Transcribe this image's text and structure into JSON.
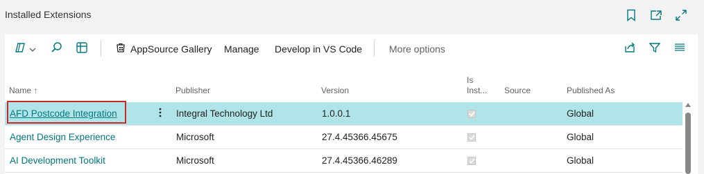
{
  "page": {
    "title": "Installed Extensions"
  },
  "header_actions": [
    {
      "icon": "bookmark-icon"
    },
    {
      "icon": "open-in-new-window-icon"
    },
    {
      "icon": "expand-icon"
    }
  ],
  "toolbar": {
    "view_switch_icon": "analysis-mode-icon",
    "search_icon": "search-icon",
    "layout_icon": "page-layout-icon",
    "appsource_label": "AppSource Gallery",
    "manage_label": "Manage",
    "develop_label": "Develop in VS Code",
    "more_label": "More options",
    "share_icon": "share-icon",
    "filter_icon": "filter-icon",
    "list_icon": "list-view-icon"
  },
  "table": {
    "columns": {
      "name": "Name",
      "name_sort": "↑",
      "publisher": "Publisher",
      "version": "Version",
      "is_installed_line1": "Is",
      "is_installed_line2": "Inst...",
      "source": "Source",
      "published_as": "Published As"
    },
    "rows": [
      {
        "name": "AFD Postcode Integration",
        "publisher": "Integral Technology Ltd",
        "version": "1.0.0.1",
        "is_installed": true,
        "source": "",
        "published_as": "Global",
        "selected": true
      },
      {
        "name": "Agent Design Experience",
        "publisher": "Microsoft",
        "version": "27.4.45366.45675",
        "is_installed": true,
        "source": "",
        "published_as": "Global",
        "selected": false
      },
      {
        "name": "AI Development Toolkit",
        "publisher": "Microsoft",
        "version": "27.4.45366.46289",
        "is_installed": true,
        "source": "",
        "published_as": "Global",
        "selected": false
      }
    ],
    "row_menu_icon": "more-vertical-icon"
  },
  "colors": {
    "accent": "#00787f",
    "selected_row": "#b1e4e8",
    "focus_outline": "#c62828"
  }
}
